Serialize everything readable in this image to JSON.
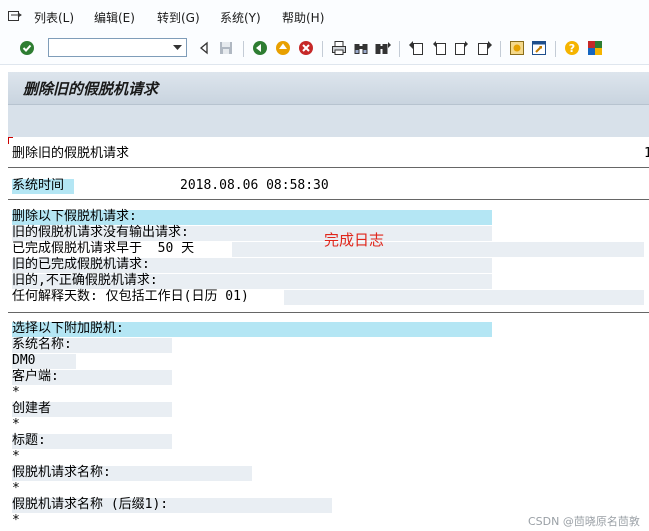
{
  "menu": {
    "items": [
      "列表(L)",
      "编辑(E)",
      "转到(G)",
      "系统(Y)",
      "帮助(H)"
    ]
  },
  "toolbar": {
    "command_value": "",
    "icons": [
      "enter-icon",
      "back-icon",
      "exit-icon",
      "cancel-icon",
      "print-icon",
      "find-icon",
      "find-next-icon",
      "first-page-icon",
      "previous-page-icon",
      "next-page-icon",
      "last-page-icon",
      "create-session-icon",
      "shortcut-icon",
      "help-icon",
      "customize-layout-icon"
    ]
  },
  "title": "删除旧的假脱机请求",
  "list": {
    "header": "删除旧的假脱机请求",
    "page_number": "1",
    "system_time_label": "系统时间",
    "system_time_value": "2018.08.06 08:58:30",
    "delete_section": {
      "heading": "删除以下假脱机请求:",
      "lines": [
        "旧的假脱机请求没有输出请求:",
        "已完成假脱机请求早于  50 天",
        "旧的已完成假脱机请求:",
        "旧的,不正确假脱机请求:",
        "任何解释天数: 仅包括工作日(日历 01)"
      ]
    },
    "stamp_text": "完成日志",
    "select_section": {
      "heading": "选择以下附加脱机:",
      "lines": [
        "系统名称:",
        "DM0",
        "客户端:",
        "*",
        "创建者",
        "*",
        "标题:",
        "*",
        "假脱机请求名称:",
        "*",
        "假脱机请求名称 (后缀1):",
        "*"
      ]
    }
  },
  "watermark": "CSDN @茴晓原名茴敦",
  "colors": {
    "highlight": "#b4e6f4",
    "stamp": "#e0261b",
    "title_bar": "#dde5ed"
  }
}
